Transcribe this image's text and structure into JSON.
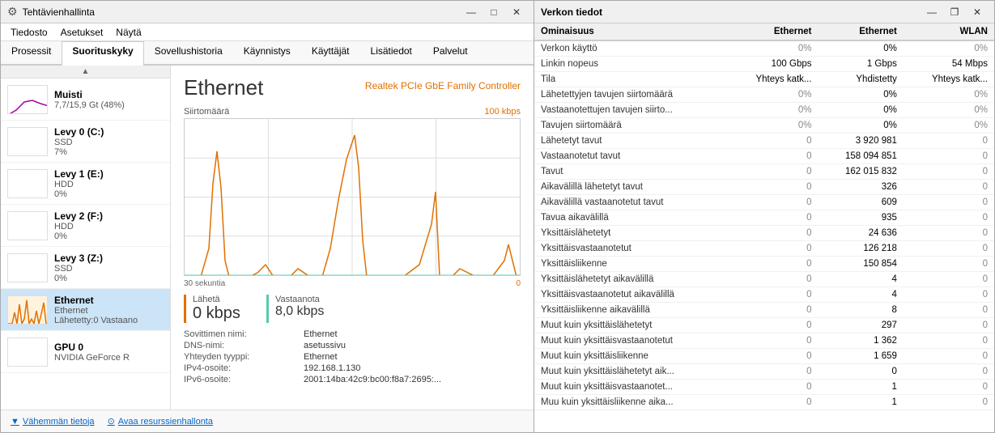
{
  "taskManager": {
    "titleBar": {
      "icon": "⚙",
      "title": "Tehtävienhallinta",
      "minimize": "—",
      "maximize": "□",
      "close": "✕"
    },
    "menu": [
      "Tiedosto",
      "Asetukset",
      "Näytä"
    ],
    "tabs": [
      "Prosessit",
      "Suorituskyky",
      "Sovellushistoria",
      "Käynnistys",
      "Käyttäjät",
      "Lisätiedot",
      "Palvelut"
    ],
    "activeTab": "Suorituskyky",
    "sidebar": {
      "scrollUp": "▲",
      "items": [
        {
          "name": "7,7/15,9 Gt (48%)",
          "sub": "",
          "type": "memory",
          "active": false
        },
        {
          "name": "Levy 0 (C:)",
          "sub": "SSD",
          "detail": "7%",
          "type": "disk",
          "active": false
        },
        {
          "name": "Levy 1 (E:)",
          "sub": "HDD",
          "detail": "0%",
          "type": "disk",
          "active": false
        },
        {
          "name": "Levy 2 (F:)",
          "sub": "HDD",
          "detail": "0%",
          "type": "disk",
          "active": false
        },
        {
          "name": "Levy 3 (Z:)",
          "sub": "SSD",
          "detail": "0%",
          "type": "disk",
          "active": false
        },
        {
          "name": "Ethernet",
          "sub": "Ethernet",
          "detail": "Lähetetty:0 Vastaano",
          "type": "network",
          "active": true
        },
        {
          "name": "GPU 0",
          "sub": "NVIDIA GeForce R",
          "detail": "",
          "type": "gpu",
          "active": false
        }
      ],
      "scrollDown": "▼"
    },
    "detail": {
      "title": "Ethernet",
      "subtitle": "Realtek PCIe GbE Family Controller",
      "chartTopRight": "100 kbps",
      "chartBottomLeft": "30 sekuntia",
      "chartBottomRight": "0",
      "sendLabel": "Lähetä",
      "sendValue": "0 kbps",
      "receiveLabel": "",
      "receiveValue": "8,0 kbps",
      "infoRows": [
        {
          "label": "Sovittimen nimi:",
          "value": "Ethernet"
        },
        {
          "label": "DNS-nimi:",
          "value": "asetussivu"
        },
        {
          "label": "Yhteyden tyyppi:",
          "value": "Ethernet"
        },
        {
          "label": "IPv4-osoite:",
          "value": "192.168.1.130"
        },
        {
          "label": "IPv6-osoite:",
          "value": "2001:14ba:42c9:bc00:f8a7:2695:..."
        }
      ]
    },
    "bottomBar": {
      "lessInfo": "Vähemmän tietoja",
      "openMonitor": "Avaa resurssienhallonta"
    }
  },
  "networkPanel": {
    "titleBar": {
      "title": "Verkon tiedot",
      "minimize": "—",
      "maximize": "❐",
      "close": "✕"
    },
    "columns": [
      "Ominaisuus",
      "Ethernet",
      "Ethernet",
      "WLAN"
    ],
    "rows": [
      {
        "property": "Verkon käyttö",
        "col1": "0%",
        "col2": "0%",
        "col3": "0%"
      },
      {
        "property": "Linkin nopeus",
        "col1": "100 Gbps",
        "col2": "1 Gbps",
        "col3": "54 Mbps"
      },
      {
        "property": "Tila",
        "col1": "Yhteys katk...",
        "col2": "Yhdistetty",
        "col3": "Yhteys katk..."
      },
      {
        "property": "Lähetettyjen tavujen siirtomäärä",
        "col1": "0%",
        "col2": "0%",
        "col3": "0%"
      },
      {
        "property": "Vastaanotettujen tavujen siirto...",
        "col1": "0%",
        "col2": "0%",
        "col3": "0%"
      },
      {
        "property": "Tavujen siirtomäärä",
        "col1": "0%",
        "col2": "0%",
        "col3": "0%"
      },
      {
        "property": "Lähetetyt tavut",
        "col1": "0",
        "col2": "3 920 981",
        "col3": "0"
      },
      {
        "property": "Vastaanotetut tavut",
        "col1": "0",
        "col2": "158 094 851",
        "col3": "0"
      },
      {
        "property": "Tavut",
        "col1": "0",
        "col2": "162 015 832",
        "col3": "0"
      },
      {
        "property": "Aikavälillä lähetetyt tavut",
        "col1": "0",
        "col2": "326",
        "col3": "0"
      },
      {
        "property": "Aikavälillä vastaanotetut tavut",
        "col1": "0",
        "col2": "609",
        "col3": "0"
      },
      {
        "property": "Tavua aikavälillä",
        "col1": "0",
        "col2": "935",
        "col3": "0"
      },
      {
        "property": "Yksittäislähetetyt",
        "col1": "0",
        "col2": "24 636",
        "col3": "0"
      },
      {
        "property": "Yksittäisvastaanotetut",
        "col1": "0",
        "col2": "126 218",
        "col3": "0"
      },
      {
        "property": "Yksittäisliikenne",
        "col1": "0",
        "col2": "150 854",
        "col3": "0"
      },
      {
        "property": "Yksittäislähetetyt aikavälillä",
        "col1": "0",
        "col2": "4",
        "col3": "0"
      },
      {
        "property": "Yksittäisvastaanotetut aikavälillä",
        "col1": "0",
        "col2": "4",
        "col3": "0"
      },
      {
        "property": "Yksittäisliikenne aikavälillä",
        "col1": "0",
        "col2": "8",
        "col3": "0"
      },
      {
        "property": "Muut kuin yksittäislähetetyt",
        "col1": "0",
        "col2": "297",
        "col3": "0"
      },
      {
        "property": "Muut kuin yksittäisvastaanotetut",
        "col1": "0",
        "col2": "1 362",
        "col3": "0"
      },
      {
        "property": "Muut kuin yksittäisliikenne",
        "col1": "0",
        "col2": "1 659",
        "col3": "0"
      },
      {
        "property": "Muut kuin yksittäislähetetyt aik...",
        "col1": "0",
        "col2": "0",
        "col3": "0"
      },
      {
        "property": "Muut kuin yksittäisvastaanotet...",
        "col1": "0",
        "col2": "1",
        "col3": "0"
      },
      {
        "property": "Muu kuin yksittäisliikenne aika...",
        "col1": "0",
        "col2": "1",
        "col3": "0"
      }
    ]
  }
}
